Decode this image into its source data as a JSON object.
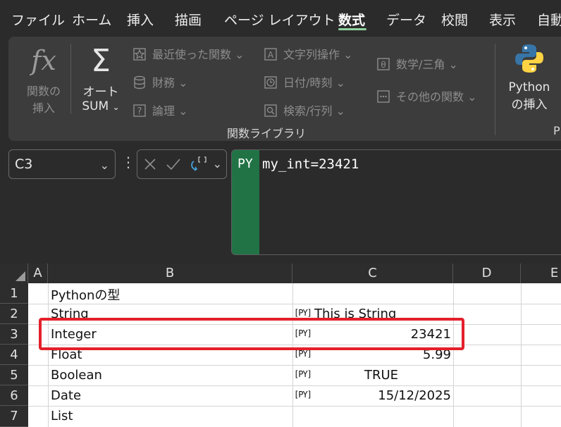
{
  "menu": {
    "tabs": [
      "ファイル",
      "ホーム",
      "挿入",
      "描画",
      "ページ レイアウト",
      "数式",
      "データ",
      "校閲",
      "表示",
      "自動"
    ],
    "active_tab": "数式"
  },
  "ribbon": {
    "insert_function": {
      "icon": "fx-icon",
      "label_line1": "関数の",
      "label_line2": "挿入"
    },
    "autosum": {
      "icon": "sigma-icon",
      "label_line1": "オート",
      "label_line2": "SUM"
    },
    "recent": "最近使った関数",
    "financial": "財務",
    "logical": "論理",
    "text": "文字列操作",
    "datetime": "日付/時刻",
    "lookup": "検索/行列",
    "math": "数学/三角",
    "more": "その他の関数",
    "python": {
      "icon": "python-logo-icon",
      "label_line1": "Python",
      "label_line2": "の挿入"
    },
    "group_label": "関数ライブラリ",
    "cut_label": "P"
  },
  "formula_bar": {
    "name_box": "C3",
    "badge": "PY",
    "formula": "my_int=23421"
  },
  "sheet": {
    "columns": [
      "A",
      "B",
      "C",
      "D",
      "E"
    ],
    "rows": [
      "1",
      "2",
      "3",
      "4",
      "5",
      "6",
      "7"
    ],
    "py_marker": "[PY]",
    "cells": {
      "b1": "Pythonの型",
      "b2": "String",
      "b3": "Integer",
      "b4": "Float",
      "b5": "Boolean",
      "b6": "Date",
      "b7": "List",
      "c2": "This is String",
      "c3": "23421",
      "c4": "5.99",
      "c5": "TRUE",
      "c6": "15/12/2025"
    }
  },
  "colors": {
    "accent_green": "#217346",
    "highlight_red": "#e3202a",
    "python_blue": "#3775a9",
    "python_yellow": "#ffd343"
  }
}
